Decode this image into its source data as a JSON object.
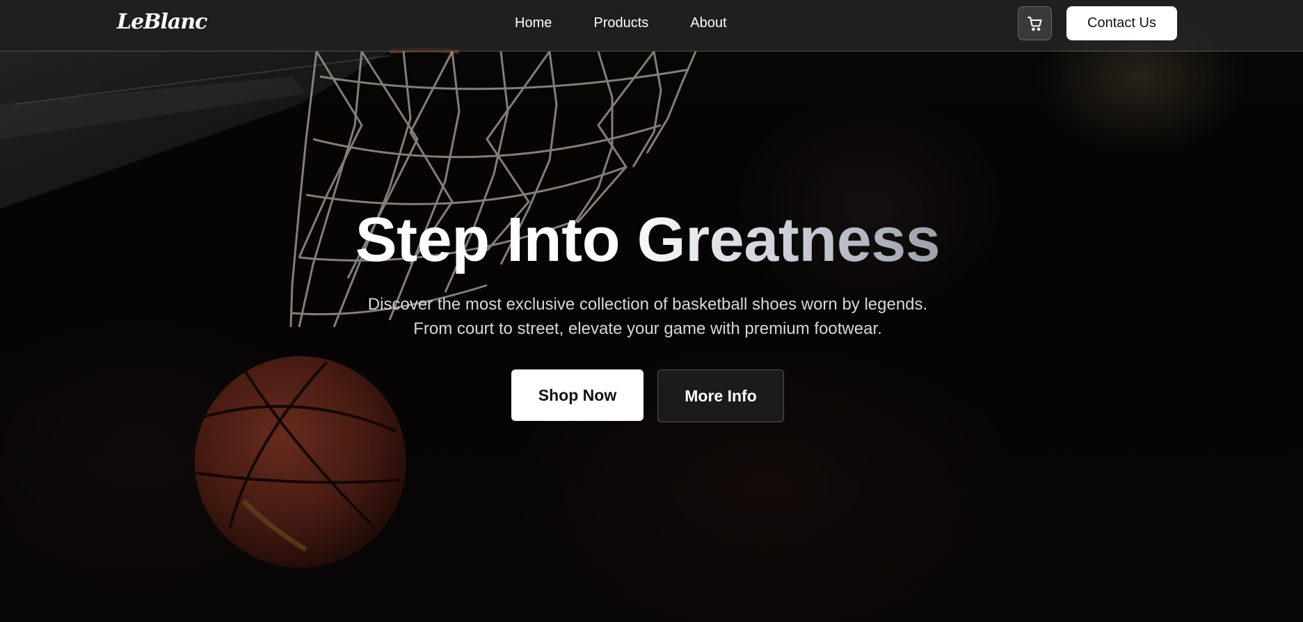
{
  "brand": {
    "logo_text": "LeBlanc"
  },
  "nav": {
    "links": [
      {
        "label": "Home"
      },
      {
        "label": "Products"
      },
      {
        "label": "About"
      }
    ],
    "cart_icon": "cart-icon",
    "contact_label": "Contact Us"
  },
  "hero": {
    "title": "Step Into Greatness",
    "subtitle_line1": "Discover the most exclusive collection of basketball shoes worn by legends.",
    "subtitle_line2": "From court to street, elevate your game with premium footwear.",
    "primary_cta": "Shop Now",
    "secondary_cta": "More Info"
  },
  "colors": {
    "nav_background": "#282828",
    "button_primary_bg": "#ffffff",
    "button_secondary_bg": "#1c1b1a",
    "hero_background": "#070605"
  }
}
